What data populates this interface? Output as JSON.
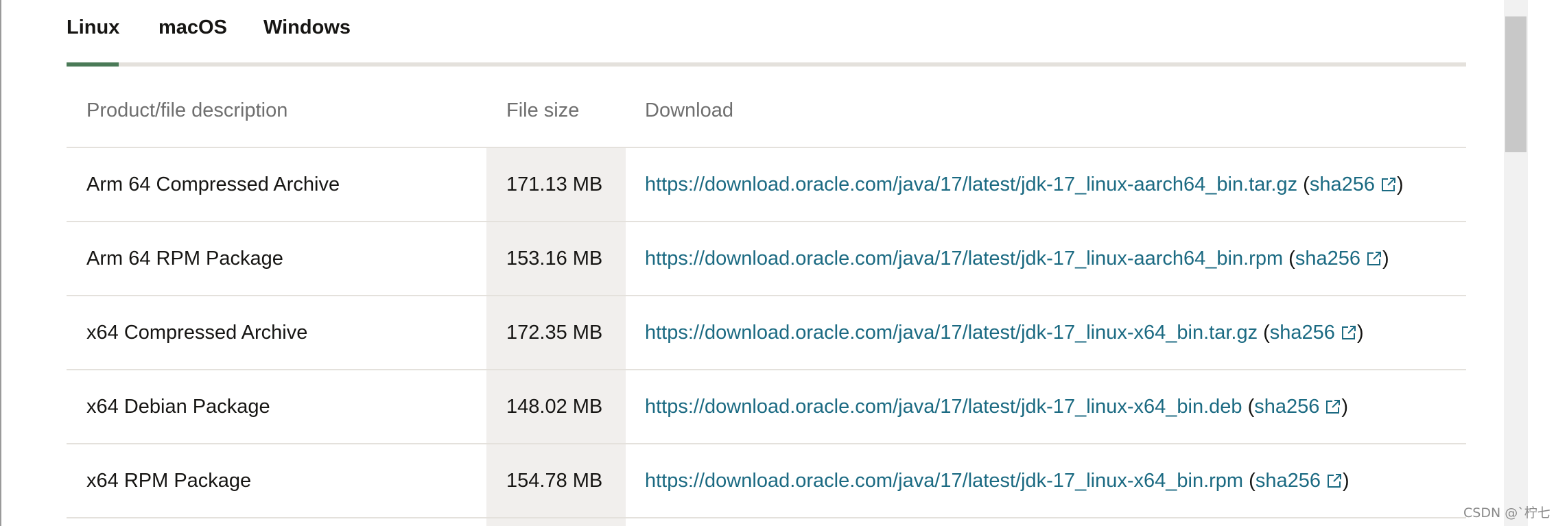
{
  "tabs": [
    {
      "label": "Linux",
      "active": true
    },
    {
      "label": "macOS",
      "active": false
    },
    {
      "label": "Windows",
      "active": false
    }
  ],
  "table": {
    "headers": {
      "description": "Product/file description",
      "size": "File size",
      "download": "Download"
    },
    "rows": [
      {
        "description": "Arm 64 Compressed Archive",
        "size": "171.13 MB",
        "url": "https://download.oracle.com/java/17/latest/jdk-17_linux-aarch64_bin.tar.gz",
        "checksum": "sha256"
      },
      {
        "description": "Arm 64 RPM Package",
        "size": "153.16 MB",
        "url": "https://download.oracle.com/java/17/latest/jdk-17_linux-aarch64_bin.rpm",
        "checksum": "sha256"
      },
      {
        "description": "x64 Compressed Archive",
        "size": "172.35 MB",
        "url": "https://download.oracle.com/java/17/latest/jdk-17_linux-x64_bin.tar.gz",
        "checksum": "sha256"
      },
      {
        "description": "x64 Debian Package",
        "size": "148.02 MB",
        "url": "https://download.oracle.com/java/17/latest/jdk-17_linux-x64_bin.deb",
        "checksum": "sha256"
      },
      {
        "description": "x64 RPM Package",
        "size": "154.78 MB",
        "url": "https://download.oracle.com/java/17/latest/jdk-17_linux-x64_bin.rpm",
        "checksum": "sha256"
      }
    ]
  },
  "watermark": "CSDN @`柠七",
  "colors": {
    "link": "#1b6a82",
    "tab_indicator": "#4a7a57",
    "size_column_bg": "#f1efed",
    "divider": "#e4e1dc"
  },
  "icons": {
    "checksum_link": "external-link-icon"
  }
}
